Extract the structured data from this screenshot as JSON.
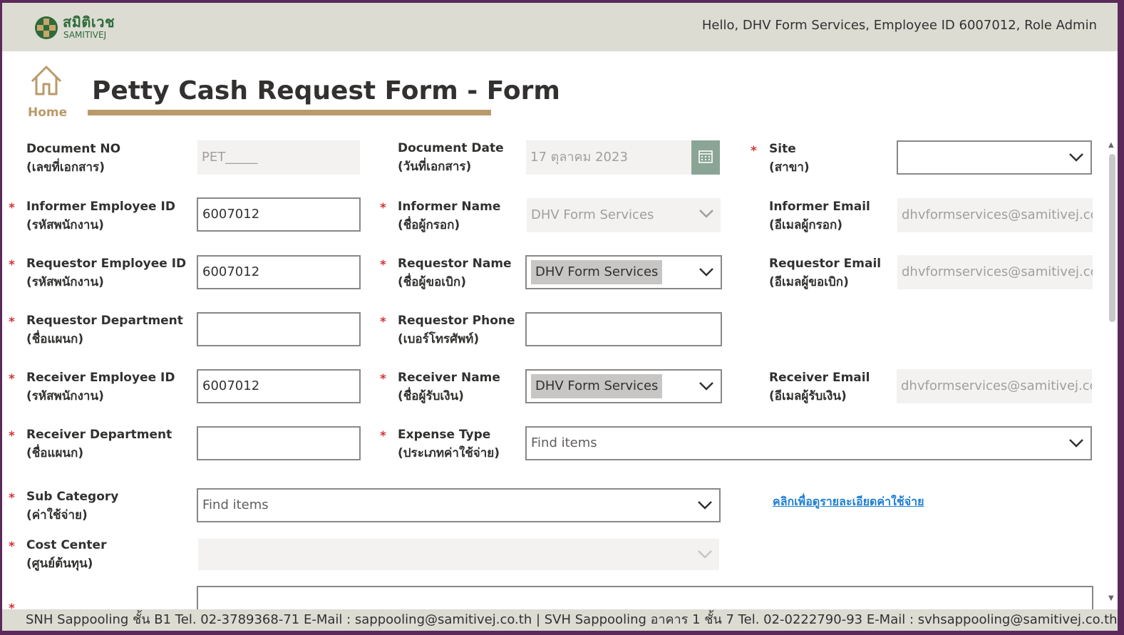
{
  "header": {
    "logo_th": "สมิติเวช",
    "logo_en": "SAMITIVEJ",
    "greeting": "Hello, DHV Form Services, Employee ID 6007012, Role Admin"
  },
  "nav": {
    "home_label": "Home"
  },
  "page": {
    "title": "Petty Cash Request Form - Form"
  },
  "fields": {
    "document_no": {
      "label": "Document NO",
      "label_th": "(เลขที่เอกสาร)",
      "value": "PET_____"
    },
    "document_date": {
      "label": "Document Date",
      "label_th": "(วันที่เอกสาร)",
      "value": "17 ตุลาคม 2023"
    },
    "site": {
      "label": "Site",
      "label_th": "(สาขา)",
      "value": ""
    },
    "informer_employee_id": {
      "label": "Informer Employee ID",
      "label_th": "(รหัสพนักงาน)",
      "value": "6007012"
    },
    "informer_name": {
      "label": "Informer Name",
      "label_th": "(ชื่อผู้กรอก)",
      "value": "DHV Form Services"
    },
    "informer_email": {
      "label": "Informer Email",
      "label_th": "(อีเมลผู้กรอก)",
      "value": "dhvformservices@samitivej.cc"
    },
    "requestor_employee_id": {
      "label": "Requestor Employee ID",
      "label_th": "(รหัสพนักงาน)",
      "value": "6007012"
    },
    "requestor_name": {
      "label": "Requestor Name",
      "label_th": "(ชื่อผู้ขอเบิก)",
      "value": "DHV Form Services"
    },
    "requestor_email": {
      "label": "Requestor Email",
      "label_th": "(อีเมลผู้ขอเบิก)",
      "value": "dhvformservices@samitivej.cc"
    },
    "requestor_department": {
      "label": "Requestor Department",
      "label_th": "(ชื่อแผนก)",
      "value": ""
    },
    "requestor_phone": {
      "label": "Requestor Phone",
      "label_th": "(เบอร์โทรศัพท์)",
      "value": ""
    },
    "receiver_employee_id": {
      "label": "Receiver Employee ID",
      "label_th": "(รหัสพนักงาน)",
      "value": "6007012"
    },
    "receiver_name": {
      "label": "Receiver Name",
      "label_th": "(ชื่อผู้รับเงิน)",
      "value": "DHV Form Services"
    },
    "receiver_email": {
      "label": "Receiver Email",
      "label_th": "(อีเมลผู้รับเงิน)",
      "value": "dhvformservices@samitivej.cc"
    },
    "receiver_department": {
      "label": "Receiver Department",
      "label_th": "(ชื่อแผนก)",
      "value": ""
    },
    "expense_type": {
      "label": "Expense Type",
      "label_th": "(ประเภทค่าใช้จ่าย)",
      "placeholder": "Find items"
    },
    "sub_category": {
      "label": "Sub Category",
      "label_th": "(ค่าใช้จ่าย)",
      "placeholder": "Find items"
    },
    "cost_center": {
      "label": "Cost Center",
      "label_th": "(ศูนย์ต้นทุน)",
      "value": ""
    },
    "expense_detail_link": "คลิกเพื่อดูรายละเอียดค่าใช้จ่าย"
  },
  "required_mark": "*",
  "footer": {
    "text": "SNH Sappooling ชั้น B1  Tel. 02-3789368-71  E-Mail : sappooling@samitivej.co.th | SVH Sappooling อาคาร 1 ชั้น 7  Tel. 02-0222790-93  E-Mail : svhsappooling@samitivej.co.th"
  },
  "colors": {
    "accent": "#b99a68",
    "topbar": "#dcdcd3",
    "required": "#d13438",
    "link": "#1e7ed4",
    "window_border": "#5b2a5a"
  }
}
